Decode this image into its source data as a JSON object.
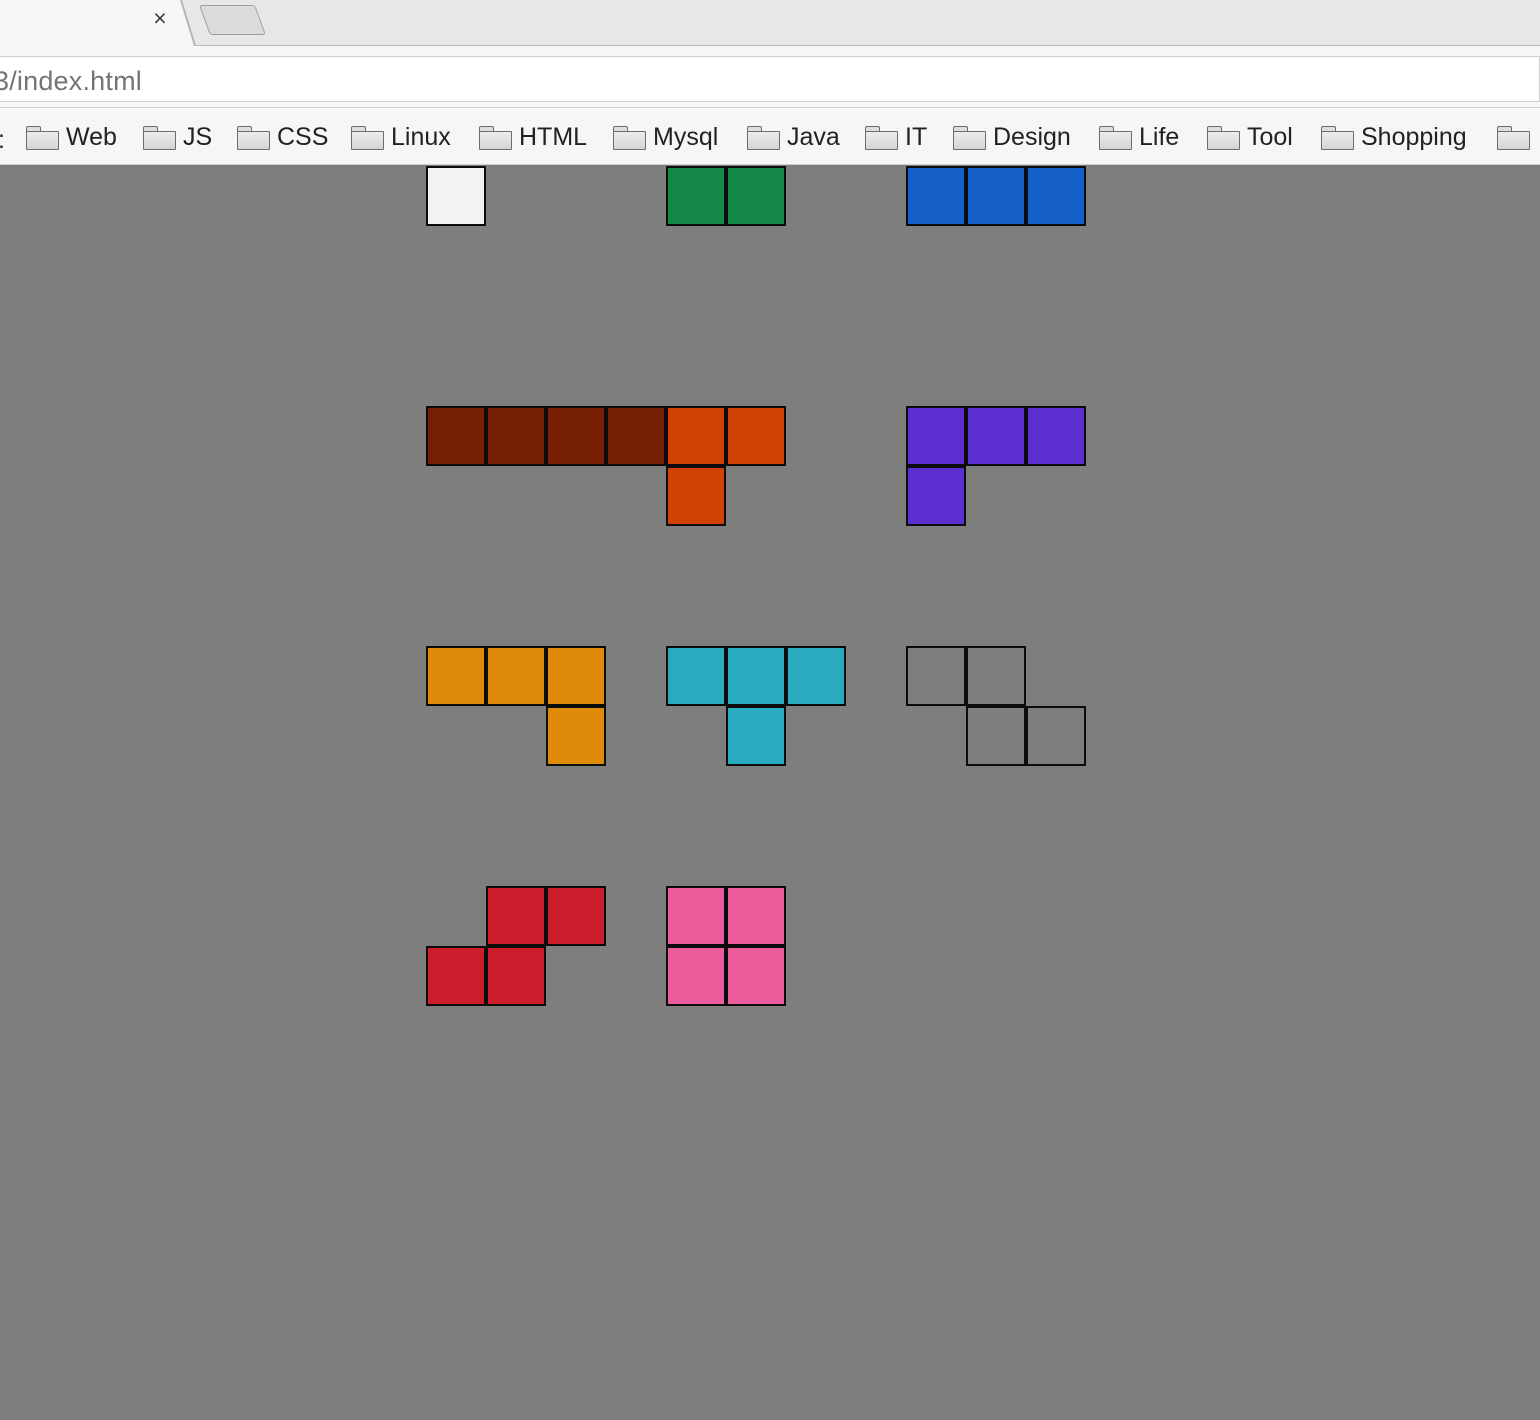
{
  "browser": {
    "tab_close_glyph": "×",
    "url": "3/index.html",
    "bookmarks": [
      {
        "label": "Web",
        "icon": "folder-icon"
      },
      {
        "label": "JS",
        "icon": "folder-icon"
      },
      {
        "label": "CSS",
        "icon": "folder-icon"
      },
      {
        "label": "Linux",
        "icon": "folder-icon"
      },
      {
        "label": "HTML",
        "icon": "folder-icon"
      },
      {
        "label": "Mysql",
        "icon": "folder-icon"
      },
      {
        "label": "Java",
        "icon": "folder-icon"
      },
      {
        "label": "IT",
        "icon": "folder-icon"
      },
      {
        "label": "Design",
        "icon": "folder-icon"
      },
      {
        "label": "Life",
        "icon": "folder-icon"
      },
      {
        "label": "Tool",
        "icon": "folder-icon"
      },
      {
        "label": "Shopping",
        "icon": "folder-icon"
      },
      {
        "label": "",
        "icon": "folder-icon"
      }
    ]
  },
  "page": {
    "background": "#7e7e7d",
    "pieces": [
      {
        "name": "piece-white-single",
        "color": "#f2f2f2",
        "cells": [
          [
            0,
            0
          ]
        ]
      },
      {
        "name": "piece-green-domino",
        "color": "#138847",
        "cells": [
          [
            0,
            0
          ],
          [
            1,
            0
          ]
        ]
      },
      {
        "name": "piece-blue-triple",
        "color": "#1560c8",
        "cells": [
          [
            0,
            0
          ],
          [
            1,
            0
          ],
          [
            2,
            0
          ]
        ]
      },
      {
        "name": "piece-brown-i",
        "color": "#761f05",
        "cells": [
          [
            0,
            0
          ],
          [
            1,
            0
          ],
          [
            2,
            0
          ],
          [
            3,
            0
          ]
        ]
      },
      {
        "name": "piece-orange-l",
        "color": "#d24207",
        "cells": [
          [
            0,
            0
          ],
          [
            1,
            0
          ],
          [
            0,
            1
          ]
        ]
      },
      {
        "name": "piece-purple-l",
        "color": "#5b2ecf",
        "cells": [
          [
            0,
            0
          ],
          [
            1,
            0
          ],
          [
            2,
            0
          ],
          [
            0,
            1
          ]
        ]
      },
      {
        "name": "piece-amber-j",
        "color": "#df8a08",
        "cells": [
          [
            0,
            0
          ],
          [
            1,
            0
          ],
          [
            2,
            0
          ],
          [
            2,
            1
          ]
        ]
      },
      {
        "name": "piece-cyan-t",
        "color": "#2aaabf",
        "cells": [
          [
            0,
            0
          ],
          [
            1,
            0
          ],
          [
            2,
            0
          ],
          [
            1,
            1
          ]
        ]
      },
      {
        "name": "piece-outline-z",
        "color": "#7e7e7d",
        "cells": [
          [
            0,
            0
          ],
          [
            1,
            0
          ],
          [
            1,
            1
          ],
          [
            2,
            1
          ]
        ]
      },
      {
        "name": "piece-red-s",
        "color": "#cc1d2c",
        "cells": [
          [
            1,
            0
          ],
          [
            2,
            0
          ],
          [
            0,
            1
          ],
          [
            1,
            1
          ]
        ]
      },
      {
        "name": "piece-pink-o",
        "color": "#ec5b9b",
        "cells": [
          [
            0,
            0
          ],
          [
            1,
            0
          ],
          [
            0,
            1
          ],
          [
            1,
            1
          ]
        ]
      }
    ]
  }
}
